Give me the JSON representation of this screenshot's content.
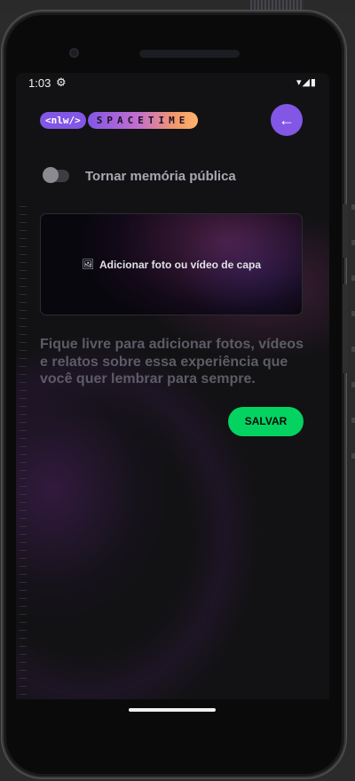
{
  "status_bar": {
    "time": "1:03",
    "gear_icon": "gear",
    "system_icons": "▾◢▮"
  },
  "logo": {
    "nlw": "<nlw/>",
    "spacetime": "SPACETIME"
  },
  "back_button": {
    "icon": "←"
  },
  "visibility": {
    "label": "Tornar memória pública",
    "enabled": false
  },
  "cover": {
    "icon": "image-icon",
    "label": "Adicionar foto ou vídeo de capa"
  },
  "description": {
    "placeholder": "Fique livre para adicionar fotos, vídeos e relatos sobre essa experiência que você quer lembrar para sempre."
  },
  "save_button": {
    "label": "SALVAR"
  },
  "colors": {
    "accent": "#8257e5",
    "save": "#04d361",
    "background": "#121214"
  }
}
